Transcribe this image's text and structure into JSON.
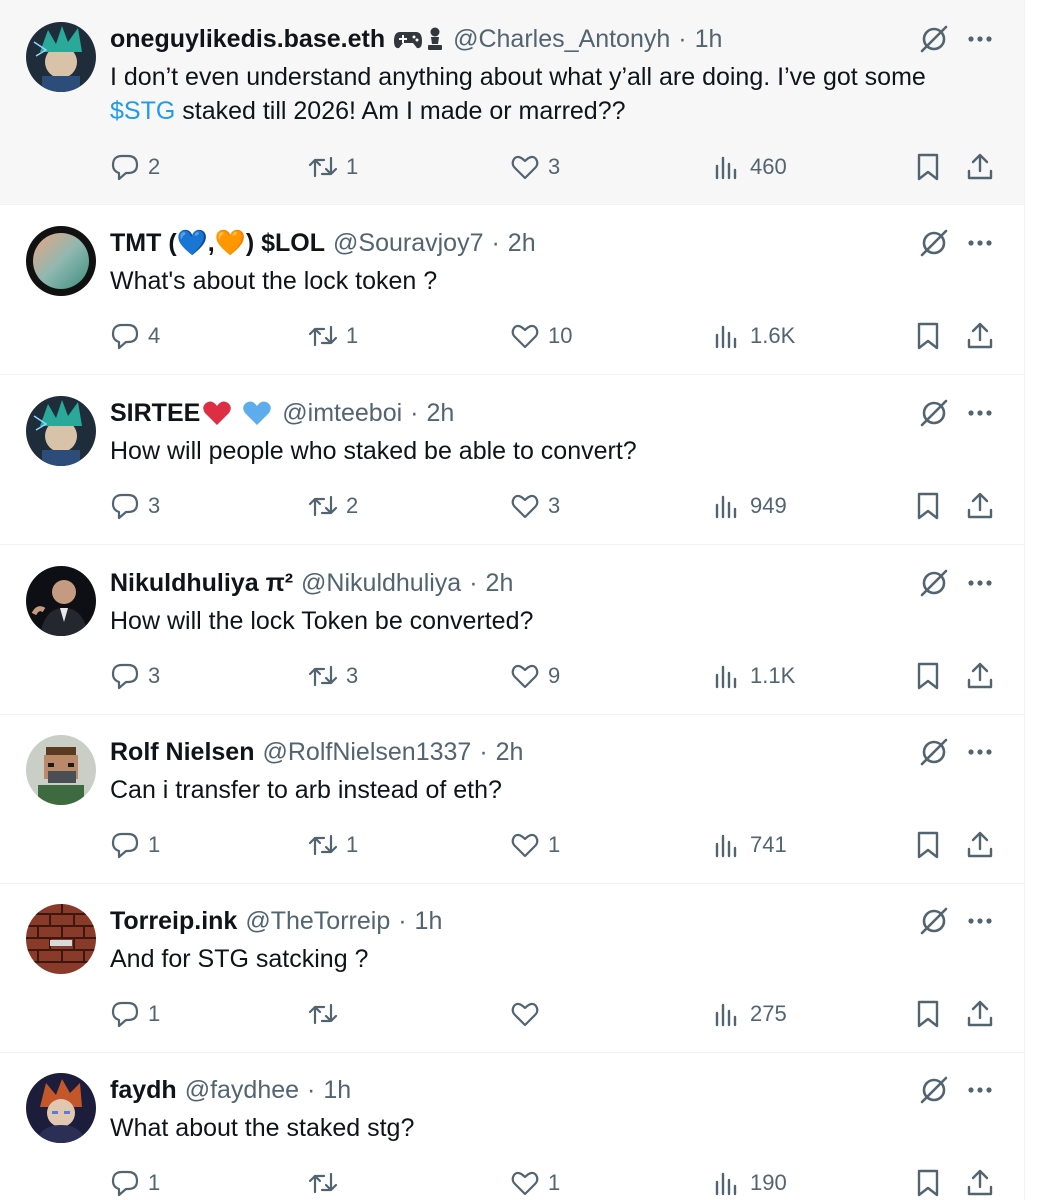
{
  "replies": [
    {
      "name": "oneguylikedis.base.eth",
      "emoji": [
        "game-controller-emoji",
        "chess-pawn-emoji"
      ],
      "handle": "@Charles_Antonyh",
      "sep": "·",
      "time": "1h",
      "text_before": "I don’t even understand anything about what y’all are doing. I’ve got some ",
      "cashtag": "$STG",
      "text_after": " staked till 2026! Am I made or marred??",
      "replies": "2",
      "reposts": "1",
      "likes": "3",
      "views": "460",
      "avatar": "anime-character-green-hair"
    },
    {
      "name": "TMT (💙,🧡) $LOL",
      "handle": "@Souravjoy7",
      "sep": "·",
      "time": "2h",
      "text": "What's about the lock token ?",
      "replies": "4",
      "reposts": "1",
      "likes": "10",
      "views": "1.6K",
      "avatar": "gradient-orb"
    },
    {
      "name": "SIRTEE",
      "emoji": [
        "red-heart-emoji",
        "blue-heart-badge"
      ],
      "handle": "@imteeboi",
      "sep": "·",
      "time": "2h",
      "text": "How will people who staked be able to convert?",
      "replies": "3",
      "reposts": "2",
      "likes": "3",
      "views": "949",
      "avatar": "anime-character-green-hair"
    },
    {
      "name": "Nikuldhuliya π²",
      "handle": "@Nikuldhuliya",
      "sep": "·",
      "time": "2h",
      "text": "How will the lock Token be converted?",
      "replies": "3",
      "reposts": "3",
      "likes": "9",
      "views": "1.1K",
      "avatar": "man-in-suit-dark-background"
    },
    {
      "name": "Rolf Nielsen",
      "handle": "@RolfNielsen1337",
      "sep": "·",
      "time": "2h",
      "text": "Can i transfer to arb instead of eth?",
      "replies": "1",
      "reposts": "1",
      "likes": "1",
      "views": "741",
      "avatar": "pixel-art-masked-character"
    },
    {
      "name": "Torreip.ink",
      "handle": "@TheTorreip",
      "sep": "·",
      "time": "1h",
      "text": "And for STG satcking ?",
      "replies": "1",
      "reposts": "",
      "likes": "",
      "views": "275",
      "avatar": "brick-wall"
    },
    {
      "name": "faydh",
      "handle": "@faydhee",
      "sep": "·",
      "time": "1h",
      "text": "What about the staked stg?",
      "replies": "1",
      "reposts": "",
      "likes": "1",
      "views": "190",
      "avatar": "anime-character-orange-hair"
    }
  ],
  "icons": {
    "reply": "reply-icon",
    "repost": "repost-icon",
    "like": "like-icon",
    "views": "views-icon",
    "bookmark": "bookmark-icon",
    "share": "share-icon",
    "grok": "grok-icon",
    "more": "more-icon"
  },
  "colors": {
    "text": "#0f1419",
    "muted": "#536471",
    "link": "#1d9bf0",
    "hover_bg": "#f7f7f7",
    "divider": "#eff3f4"
  }
}
